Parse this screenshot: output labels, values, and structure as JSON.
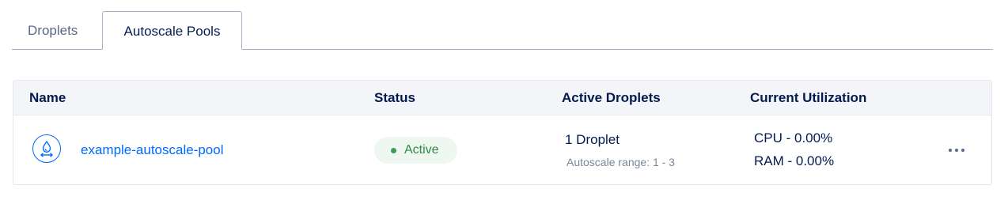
{
  "tabs": {
    "droplets": "Droplets",
    "autoscale_pools": "Autoscale Pools",
    "active_tab": "Autoscale Pools"
  },
  "table": {
    "headers": {
      "name": "Name",
      "status": "Status",
      "active_droplets": "Active Droplets",
      "current_utilization": "Current Utilization"
    },
    "rows": [
      {
        "icon": "autoscale-pool-icon",
        "name": "example-autoscale-pool",
        "status": "Active",
        "droplet_count": "1 Droplet",
        "autoscale_range": "Autoscale range: 1 - 3",
        "cpu": "CPU - 0.00%",
        "ram": "RAM - 0.00%",
        "actions_icon": "more-horizontal-icon"
      }
    ]
  },
  "colors": {
    "accent": "#0069ff",
    "status_active": "#3c9f52",
    "text": "#031b4e",
    "muted": "#5b6987"
  }
}
